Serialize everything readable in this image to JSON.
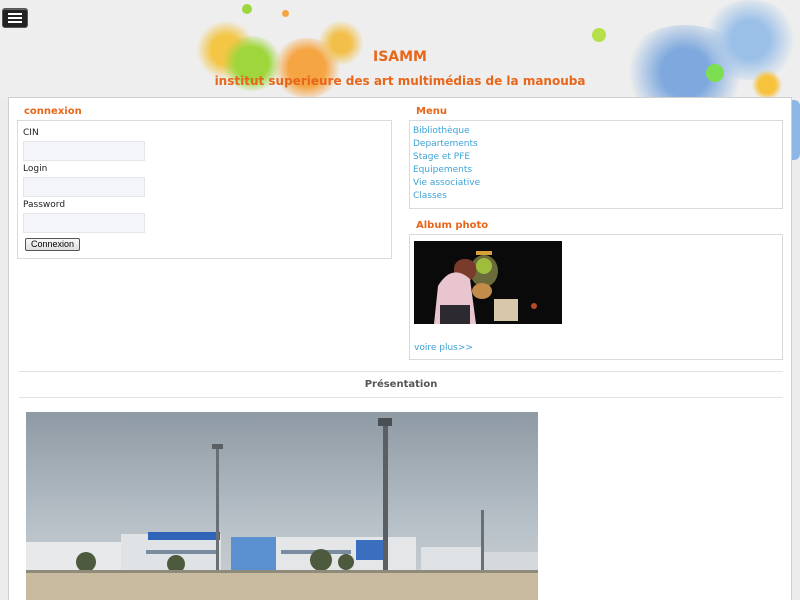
{
  "header": {
    "title": "ISAMM",
    "subtitle": "institut superieure des art multimédias de la manouba"
  },
  "login": {
    "section_title": "connexion",
    "cin_label": "CIN",
    "cin_value": "",
    "login_label": "Login",
    "login_value": "",
    "password_label": "Password",
    "password_value": "",
    "submit_label": "Connexion"
  },
  "menu": {
    "section_title": "Menu",
    "items": [
      {
        "label": "Bibliothèque"
      },
      {
        "label": "Departements"
      },
      {
        "label": "Stage et PFE"
      },
      {
        "label": "Equipements"
      },
      {
        "label": "Vie associative"
      },
      {
        "label": "Classes"
      }
    ]
  },
  "album": {
    "section_title": "Album photo",
    "more_link": "voire plus>>"
  },
  "presentation": {
    "title": "Présentation"
  },
  "colors": {
    "accent": "#e8661a",
    "link": "#3da3d8"
  }
}
